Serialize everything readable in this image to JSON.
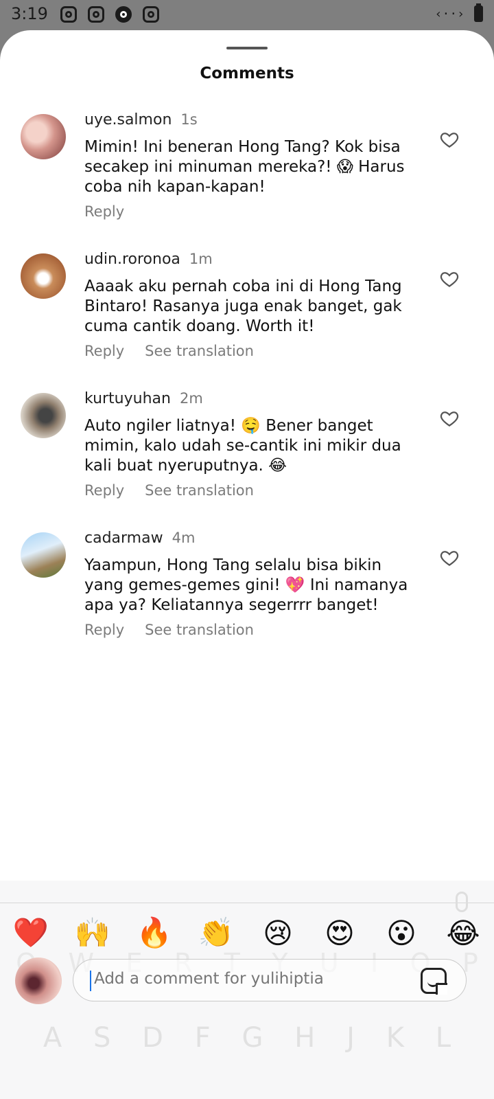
{
  "status": {
    "time": "3:19"
  },
  "sheet": {
    "title": "Comments"
  },
  "comments": [
    {
      "username": "uye.salmon",
      "time": "1s",
      "text": "Mimin! Ini beneran Hong Tang? Kok bisa secakep ini minuman mereka?! 😱 Harus coba nih kapan-kapan!",
      "reply": "Reply",
      "translation": ""
    },
    {
      "username": "udin.roronoa",
      "time": "1m",
      "text": "Aaaak aku pernah coba ini di Hong Tang Bintaro! Rasanya juga enak banget, gak cuma cantik doang. Worth it!",
      "reply": "Reply",
      "translation": "See translation"
    },
    {
      "username": "kurtuyuhan",
      "time": "2m",
      "text": "Auto ngiler liatnya! 🤤 Bener banget mimin, kalo udah se-cantik ini mikir dua kali buat nyeruputnya. 😂",
      "reply": "Reply",
      "translation": "See translation"
    },
    {
      "username": "cadarmaw",
      "time": "4m",
      "text": "Yaampun, Hong Tang selalu bisa bikin yang gemes-gemes gini! 💖 Ini namanya apa ya? Keliatannya segerrrr banget!",
      "reply": "Reply",
      "translation": "See translation"
    }
  ],
  "emojis": [
    "❤️",
    "🙌",
    "🔥",
    "👏",
    "😢",
    "😍",
    "😮",
    "😂"
  ],
  "composer": {
    "placeholder": "Add a comment for yulihiptia"
  },
  "keyboard": {
    "row_top": [
      "Q",
      "W",
      "E",
      "R",
      "T",
      "Y",
      "U",
      "I",
      "O",
      "P"
    ],
    "row_mid": [
      "A",
      "S",
      "D",
      "F",
      "G",
      "H",
      "J",
      "K",
      "L"
    ]
  },
  "colors": {
    "sheet_bg": "#ffffff",
    "scrim": "#7f7f7f",
    "meta_text": "#7b7b7b",
    "caret": "#1a73e8"
  }
}
